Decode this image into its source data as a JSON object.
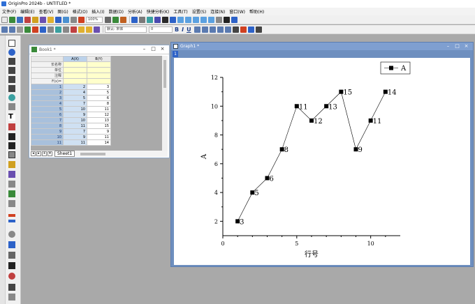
{
  "app": {
    "title": "OriginPro 2024b - UNTITLED *"
  },
  "menu": [
    "文件(F)",
    "编辑(E)",
    "查看(V)",
    "图(G)",
    "格式(O)",
    "插入(I)",
    "数据(D)",
    "分析(A)",
    "快捷分析(K)",
    "工具(T)",
    "设置(S)",
    "连接(N)",
    "窗口(W)",
    "帮助(H)"
  ],
  "toolbar": {
    "zoom": "100%",
    "font": "默认: 宋体",
    "font_size": "0",
    "bold": "B",
    "italic": "I",
    "underline": "U"
  },
  "workbook": {
    "title": "Book1 *",
    "columns": [
      "A(X)",
      "B(Y)"
    ],
    "meta_rows": [
      "长名称",
      "单位",
      "注释",
      "F(x)="
    ],
    "rows": [
      [
        "1",
        "2",
        "3"
      ],
      [
        "2",
        "4",
        "5"
      ],
      [
        "3",
        "5",
        "6"
      ],
      [
        "4",
        "7",
        "8"
      ],
      [
        "5",
        "10",
        "11"
      ],
      [
        "6",
        "9",
        "12"
      ],
      [
        "7",
        "10",
        "13"
      ],
      [
        "8",
        "11",
        "15"
      ],
      [
        "9",
        "7",
        "9"
      ],
      [
        "10",
        "9",
        "11"
      ],
      [
        "11",
        "11",
        "14"
      ]
    ],
    "sheet_tab": "Sheet1"
  },
  "graph": {
    "title": "Graph1 *",
    "layer": "1",
    "chart_data": {
      "type": "line",
      "xlabel": "行号",
      "ylabel": "A",
      "xlim": [
        0,
        12
      ],
      "ylim": [
        1,
        12
      ],
      "xticks": [
        0,
        5,
        10
      ],
      "yticks": [
        2,
        4,
        6,
        8,
        10,
        12
      ],
      "series": [
        {
          "name": "A",
          "x": [
            1,
            2,
            3,
            4,
            5,
            6,
            7,
            8,
            9,
            10,
            11
          ],
          "y": [
            2,
            4,
            5,
            7,
            10,
            9,
            10,
            11,
            7,
            9,
            11
          ],
          "labels": [
            "3",
            "5",
            "6",
            "8",
            "11",
            "12",
            "13",
            "15",
            "9",
            "11",
            "14"
          ]
        }
      ],
      "legend": "top-right"
    }
  },
  "colors": {
    "graph_frame": "#6e8fbf",
    "selected_col": "#cfe0f2",
    "meta_rows": "#ffffcc"
  }
}
